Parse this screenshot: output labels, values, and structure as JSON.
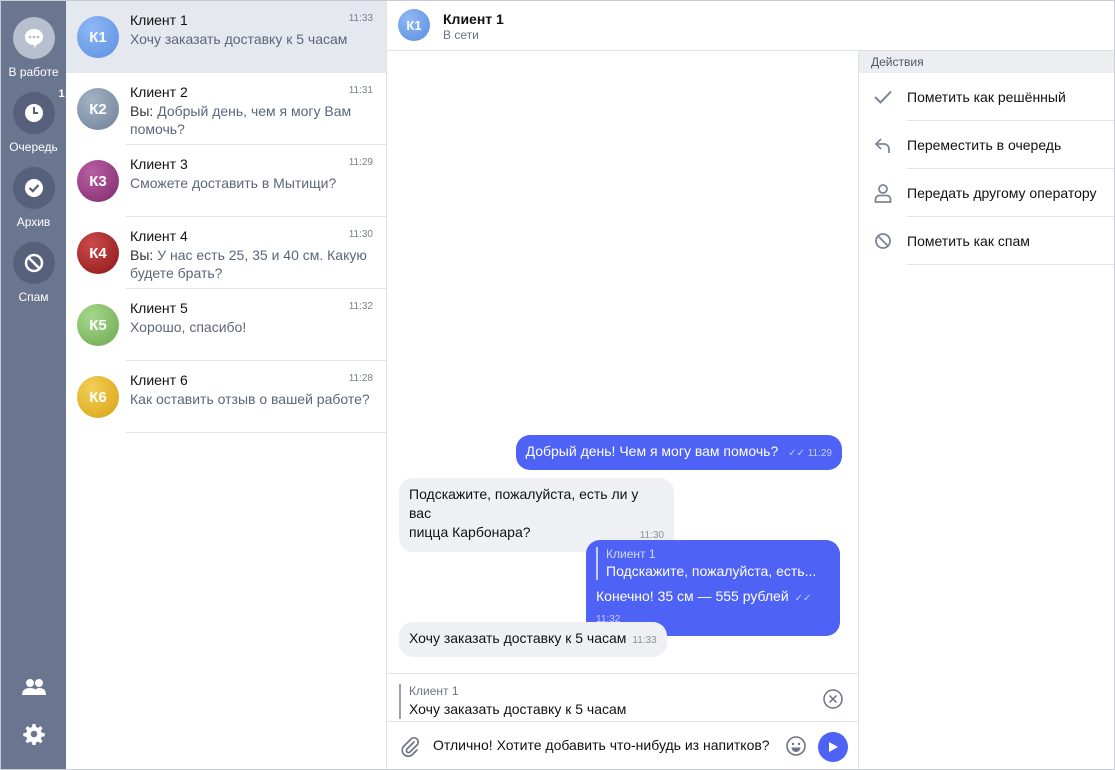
{
  "rail": {
    "in_work": "В работе",
    "queue": "Очередь",
    "queue_badge": "1",
    "archive": "Архив",
    "spam": "Спам"
  },
  "chats": [
    {
      "initials": "К1",
      "name": "Клиент 1",
      "time": "11:33",
      "you": "",
      "preview": "Хочу заказать доставку к 5 часам",
      "color": "#6d9ee8"
    },
    {
      "initials": "К2",
      "name": "Клиент 2",
      "time": "11:31",
      "you": "Вы:",
      "preview": "Добрый день, чем я могу Вам помочь?",
      "color": "#8194aa"
    },
    {
      "initials": "К3",
      "name": "Клиент 3",
      "time": "11:29",
      "you": "",
      "preview": "Сможете доставить в Мытищи?",
      "color": "#9a3a83"
    },
    {
      "initials": "К4",
      "name": "Клиент 4",
      "time": "11:30",
      "you": "Вы:",
      "preview": "У нас есть 25, 35 и 40 см. Какую будете брать?",
      "color": "#a82528"
    },
    {
      "initials": "К5",
      "name": "Клиент 5",
      "time": "11:32",
      "you": "",
      "preview": "Хорошо, спасибо!",
      "color": "#86c06a"
    },
    {
      "initials": "К6",
      "name": "Клиент 6",
      "time": "11:28",
      "you": "",
      "preview": "Как оставить отзыв о вашей работе?",
      "color": "#e6b628"
    }
  ],
  "header": {
    "initials": "К1",
    "name": "Клиент 1",
    "status": "В сети"
  },
  "messages": {
    "m1": {
      "text": "Добрый день! Чем я могу вам помочь?",
      "time": "11:29"
    },
    "m2": {
      "text1": "Подскажите, пожалуйста, есть ли у вас",
      "text2": "пицца Карбонара?",
      "time": "11:30"
    },
    "m3": {
      "quote_name": "Клиент 1",
      "quote_text": "Подскажите, пожалуйста, есть...",
      "text": "Конечно! 35 см — 555 рублей",
      "time": "11:32"
    },
    "m4": {
      "text": "Хочу заказать доставку к 5 часам",
      "time": "11:33"
    }
  },
  "reply": {
    "name": "Клиент 1",
    "text": "Хочу заказать доставку к 5 часам"
  },
  "composer": {
    "value": "Отлично! Хотите добавить что-нибудь из напитков?"
  },
  "actions": {
    "title": "Действия",
    "items": [
      {
        "label": "Пометить как решённый",
        "icon": "check-icon"
      },
      {
        "label": "Переместить в очередь",
        "icon": "reply-arrow-icon"
      },
      {
        "label": "Передать другому оператору",
        "icon": "person-icon"
      },
      {
        "label": "Пометить как спам",
        "icon": "block-icon"
      }
    ]
  },
  "colors": {
    "accent": "#4e62f5",
    "rail": "#6a7590"
  }
}
